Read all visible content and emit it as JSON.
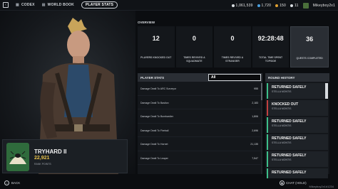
{
  "topbar": {
    "codex": "CODEX",
    "world_book": "WORLD BOOK",
    "player_stats": "PLAYER STATS",
    "currencies": [
      {
        "value": "1,061,539",
        "color": "#d8dce0"
      },
      {
        "value": "1,720",
        "color": "#4aa0e0"
      },
      {
        "value": "150",
        "color": "#e0a030"
      },
      {
        "value": "11",
        "color": "#d8dce0"
      }
    ],
    "username": "Mikeyboy2x1"
  },
  "character": {
    "name": "TRYHARD II",
    "rank_value": "22,921",
    "rank_label": "RANK POINTS"
  },
  "overview": {
    "label": "OVERVIEW",
    "cells": [
      {
        "value": "12",
        "label": "PLAYERS KNOCKED OUT"
      },
      {
        "value": "0",
        "label": "TIMES REVIVED A SQUADMATE"
      },
      {
        "value": "0",
        "label": "TIMES REVIVED A STRANGER"
      },
      {
        "value": "92:28:48",
        "label": "TOTAL TIME SPENT TOPSIDE"
      },
      {
        "value": "36",
        "label": "QUESTS COMPLETED"
      }
    ]
  },
  "player_stats": {
    "title": "PLAYER STATS",
    "filter": "All",
    "rows": [
      {
        "key": "Damage Dealt To ARC Surveyor",
        "value": "955"
      },
      {
        "key": "Damage Dealt To Bastion",
        "value": "2,183"
      },
      {
        "key": "Damage Dealt To Bombardier",
        "value": "1,806"
      },
      {
        "key": "Damage Dealt To Fireball",
        "value": "2,696"
      },
      {
        "key": "Damage Dealt To Hornet",
        "value": "21,135"
      },
      {
        "key": "Damage Dealt To Leaper",
        "value": "7,547"
      }
    ]
  },
  "round_history": {
    "title": "ROUND HISTORY",
    "items": [
      {
        "status": "RETURNED SAFELY",
        "map": "STELLA MONTIS",
        "time": "",
        "ko": false
      },
      {
        "status": "KNOCKED OUT",
        "map": "STELLA MONTIS",
        "time": "",
        "ko": true
      },
      {
        "status": "RETURNED SAFELY",
        "map": "STELLA MONTIS",
        "time": "",
        "ko": false
      },
      {
        "status": "RETURNED SAFELY",
        "map": "STELLA MONTIS",
        "time": "",
        "ko": false
      },
      {
        "status": "RETURNED SAFELY",
        "map": "STELLA MONTIS",
        "time": "",
        "ko": false
      },
      {
        "status": "RETURNED SAFELY",
        "map": "",
        "time": "",
        "ko": false
      }
    ]
  },
  "bottombar": {
    "back": "BACK",
    "chat": "CHAT (HOLD)",
    "user_id": "Mikeyboy2x1#1234"
  }
}
